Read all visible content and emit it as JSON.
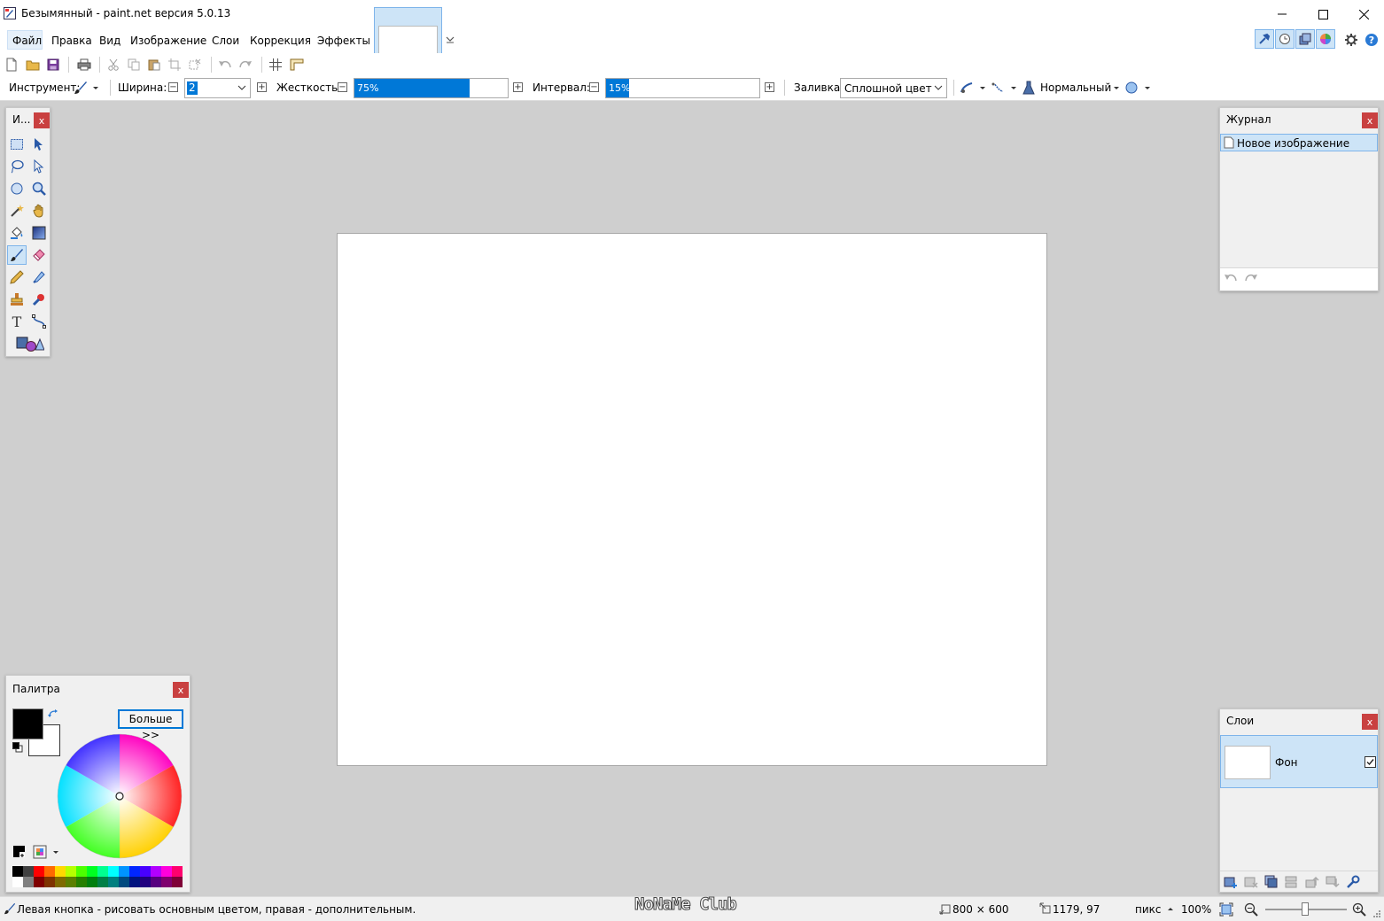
{
  "window": {
    "title": "Безымянный - paint.net версия 5.0.13"
  },
  "menu": {
    "items": [
      "Файл",
      "Правка",
      "Вид",
      "Изображение",
      "Слои",
      "Коррекция",
      "Эффекты"
    ]
  },
  "options": {
    "tool_label": "Инструмент:",
    "width_label": "Ширина:",
    "width_value": "2",
    "hardness_label": "Жесткость:",
    "hardness_value": "75%",
    "hardness_fraction": 0.75,
    "interval_label": "Интервал:",
    "interval_value": "15%",
    "interval_fraction": 0.15,
    "fill_label": "Заливка:",
    "fill_value": "Сплошной цвет",
    "blend_mode": "Нормальный"
  },
  "tools_panel": {
    "title": "И...",
    "close": "x"
  },
  "history_panel": {
    "title": "Журнал",
    "close": "x",
    "items": [
      "Новое изображение"
    ]
  },
  "palette_panel": {
    "title": "Палитра",
    "close": "x",
    "more_button": "Больше >>",
    "primary_color": "#000000",
    "secondary_color": "#ffffff",
    "swatches_top": [
      "#000000",
      "#404040",
      "#ff0000",
      "#ff6a00",
      "#ffd800",
      "#b6ff00",
      "#4cff00",
      "#00ff21",
      "#00ff90",
      "#00ffff",
      "#0094ff",
      "#0026ff",
      "#4800ff",
      "#b200ff",
      "#ff00dc",
      "#ff006e"
    ],
    "swatches_bottom": [
      "#ffffff",
      "#808080",
      "#7f0000",
      "#7f3300",
      "#7f6a00",
      "#5b7f00",
      "#267f00",
      "#007f0e",
      "#007f46",
      "#007f7f",
      "#004a7f",
      "#00137f",
      "#21007f",
      "#57007f",
      "#7f006e",
      "#7f0037"
    ]
  },
  "layers_panel": {
    "title": "Слои",
    "close": "x",
    "layers": [
      {
        "name": "Фон",
        "visible": true
      }
    ]
  },
  "status": {
    "hint": "Левая кнопка - рисовать основным цветом, правая - дополнительным.",
    "watermark": "NoNaMe Club",
    "image_size": "800 × 600",
    "cursor_pos": "1179, 97",
    "units": "пикс",
    "zoom": "100%"
  },
  "colors": {
    "accent": "#0078d7",
    "selection": "#cde4f7",
    "workspace": "#cfcfcf"
  }
}
